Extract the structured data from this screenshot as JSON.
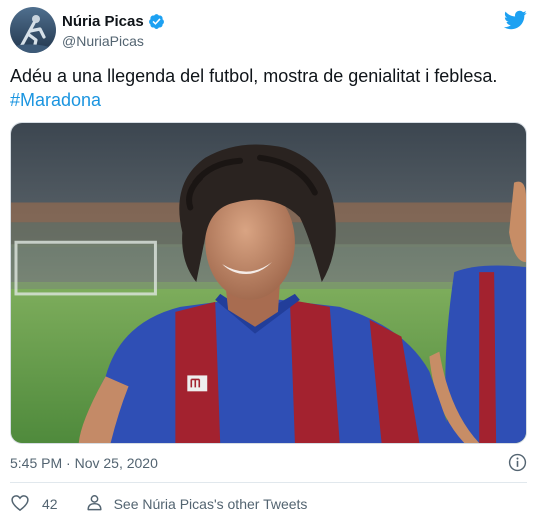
{
  "author": {
    "display_name": "Núria Picas",
    "handle": "@NuriaPicas",
    "verified": true,
    "avatar_icon": "avatar-photo"
  },
  "tweet": {
    "text": "Adéu a una llegenda del futbol, mostra de genialitat i feblesa.",
    "hashtag": "#Maradona",
    "timestamp": "5:45 PM · Nov 25, 2020",
    "media_icon": "photo-footballer-in-stadium"
  },
  "actions": {
    "like_count": "42",
    "see_more_label": "See Núria Picas's other Tweets"
  },
  "colors": {
    "link": "#1b95e0",
    "brand": "#1da1f2",
    "muted": "#536471",
    "jersey_blue": "#2f4fb5",
    "jersey_red": "#a3222f"
  },
  "icons": [
    "verified-badge-icon",
    "twitter-bird-icon",
    "info-icon",
    "heart-icon",
    "person-icon"
  ]
}
